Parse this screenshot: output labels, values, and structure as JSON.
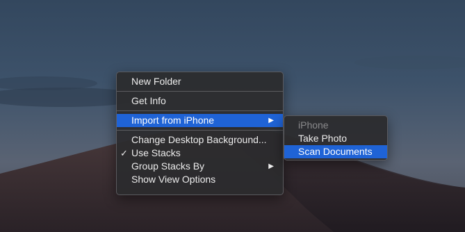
{
  "context_menu": {
    "items": [
      {
        "label": "New Folder"
      },
      {
        "label": "Get Info"
      },
      {
        "label": "Import from iPhone",
        "submenu_arrow": "▶"
      },
      {
        "label": "Change Desktop Background..."
      },
      {
        "label": "Use Stacks",
        "check": "✓"
      },
      {
        "label": "Group Stacks By",
        "submenu_arrow": "▶"
      },
      {
        "label": "Show View Options"
      }
    ]
  },
  "submenu": {
    "header": "iPhone",
    "items": [
      {
        "label": "Take Photo"
      },
      {
        "label": "Scan Documents"
      }
    ]
  },
  "colors": {
    "highlight": "#1f63d6",
    "menu_bg": "#2c2c2e",
    "text": "#ededed",
    "disabled_text": "#8a8a8c"
  }
}
